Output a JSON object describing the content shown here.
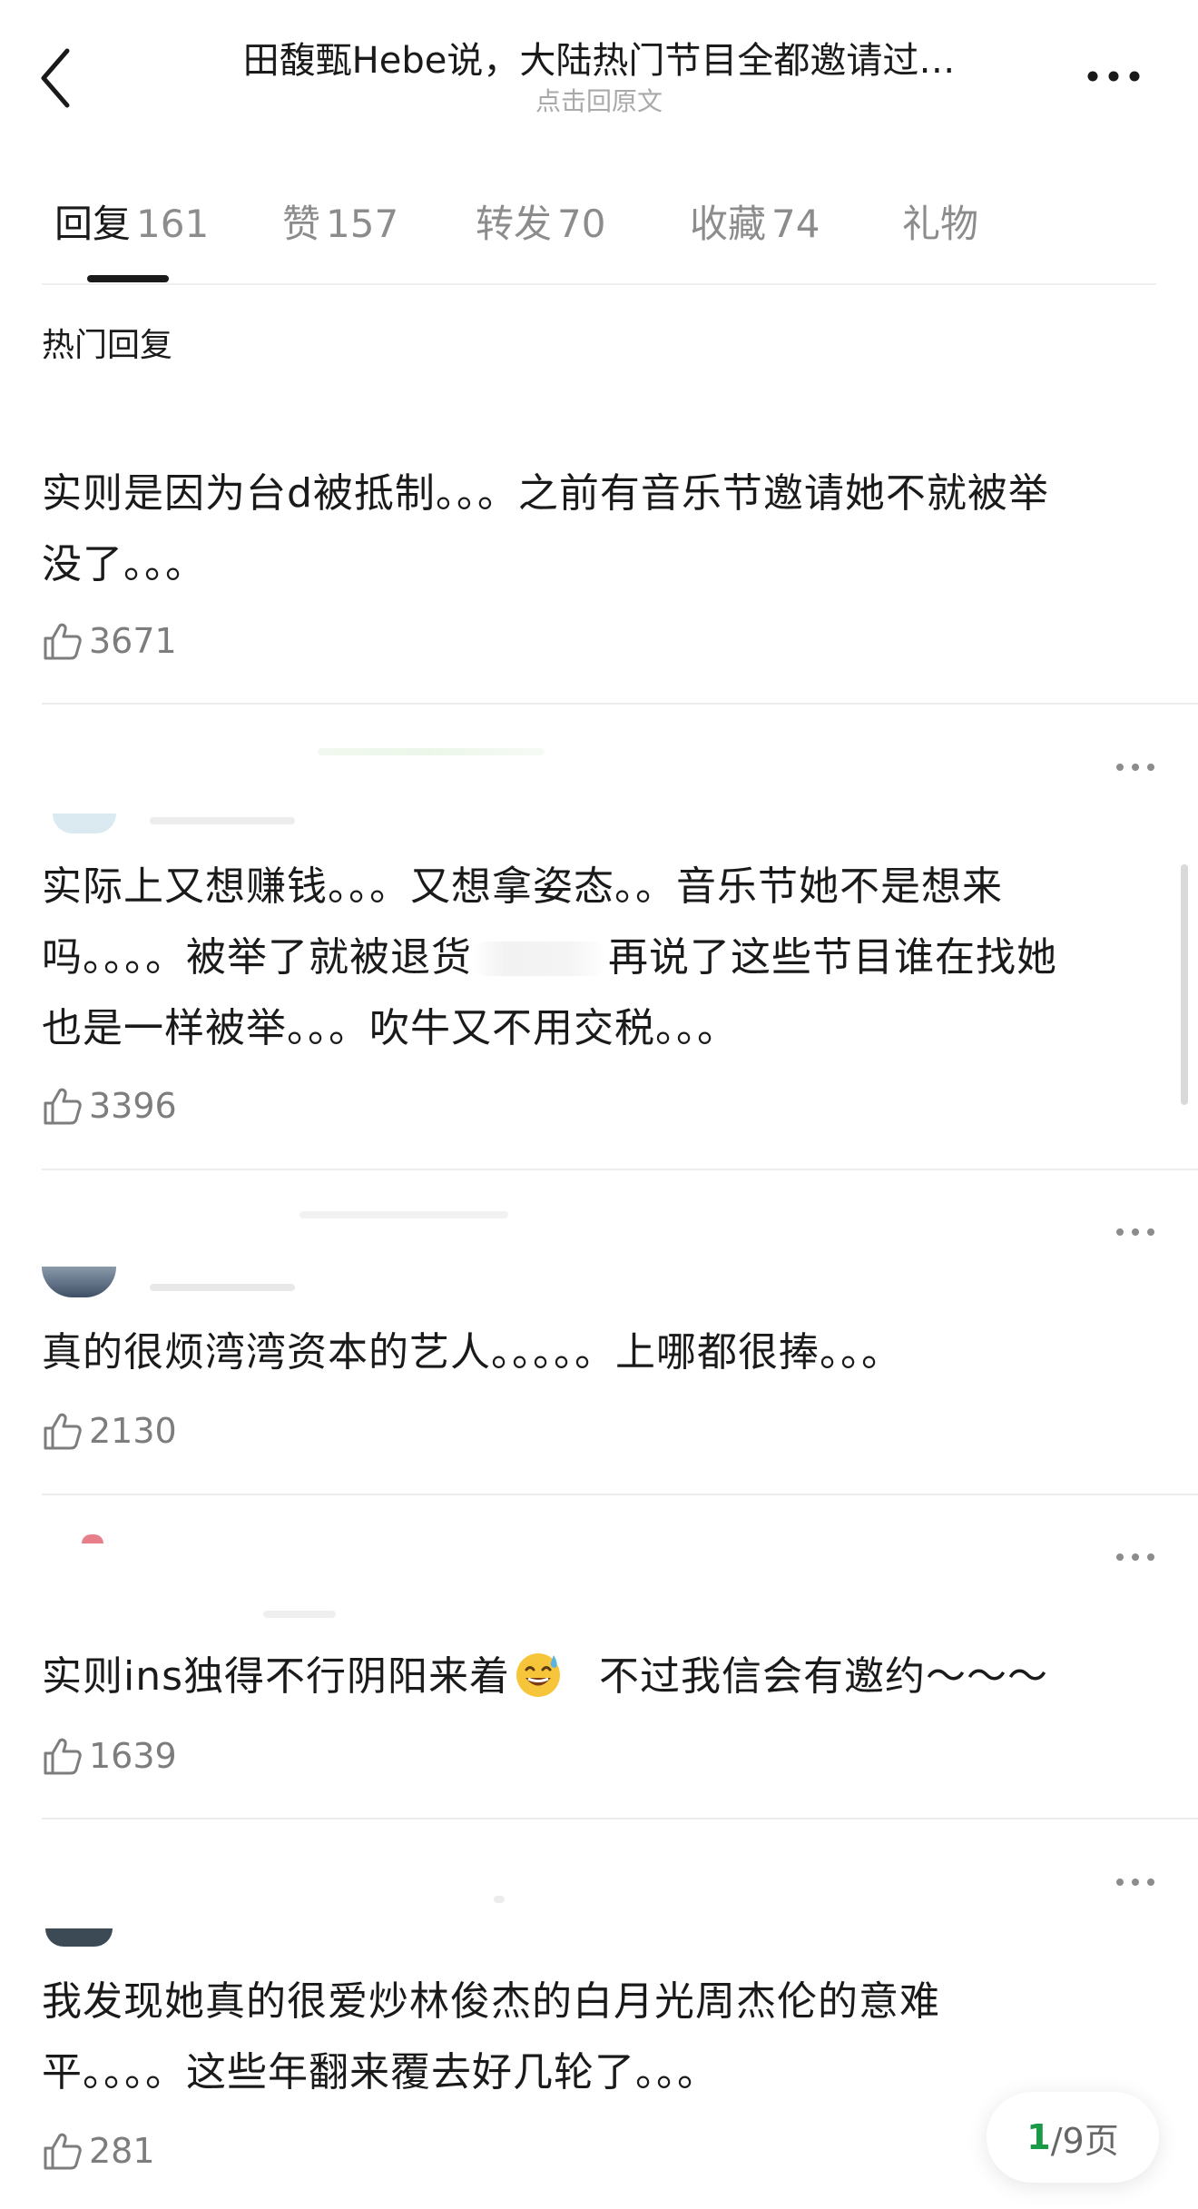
{
  "header": {
    "title": "田馥甄Hebe说，大陆热门节目全都邀请过…",
    "subtitle": "点击回原文"
  },
  "tabs": [
    {
      "label": "回复",
      "count": "161"
    },
    {
      "label": "赞",
      "count": "157"
    },
    {
      "label": "转发",
      "count": "70"
    },
    {
      "label": "收藏",
      "count": "74"
    },
    {
      "label": "礼物",
      "count": ""
    }
  ],
  "section_title": "热门回复",
  "comments": [
    {
      "lines": [
        "实则是因为台d被抵制。。。之前有音乐节邀请她不就被举",
        "没了。。。"
      ],
      "likes": "3671"
    },
    {
      "lines": [
        "实际上又想赚钱。。。又想拿姿态。。音乐节她不是想来",
        "吗。。。。被举了就被退货",
        "再说了这些节目谁在找她",
        "也是一样被举。。。吹牛又不用交税。。。"
      ],
      "likes": "3396"
    },
    {
      "lines": [
        "真的很烦湾湾资本的艺人。。。。。上哪都很捧。。。"
      ],
      "likes": "2130"
    },
    {
      "lines": [
        "实则ins独得不行阴阳来着",
        "不过我信会有邀约～～～"
      ],
      "likes": "1639"
    },
    {
      "lines": [
        "我发现她真的很爱炒林俊杰的白月光周杰伦的意难",
        "平。。。。这些年翻来覆去好几轮了。。。"
      ],
      "likes": "281"
    }
  ],
  "pager": {
    "current": "1",
    "total_text": "/9页"
  },
  "colors": {
    "accent": "#1a9a47",
    "text": "#1a1a1a",
    "muted": "#8c8c8c"
  }
}
